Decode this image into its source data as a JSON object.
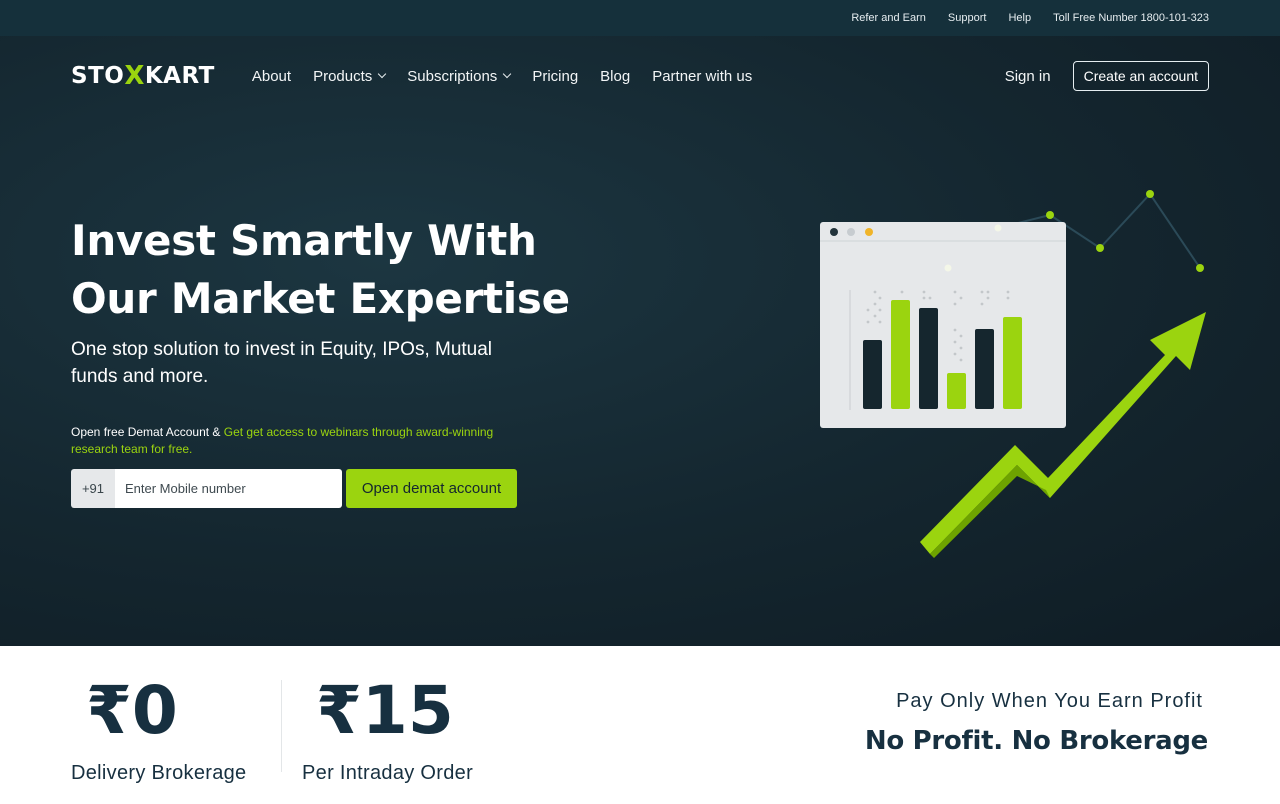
{
  "topbar": {
    "refer": "Refer and Earn",
    "support": "Support",
    "help": "Help",
    "tollfree": "Toll Free Number 1800-101-323"
  },
  "nav": {
    "logo_pre": "STO",
    "logo_x": "X",
    "logo_post": "KART",
    "links": [
      "About",
      "Products",
      "Subscriptions",
      "Pricing",
      "Blog",
      "Partner with us"
    ],
    "signin": "Sign in",
    "create": "Create an account"
  },
  "hero": {
    "headline_1": "Invest Smartly With",
    "headline_2": "Our Market Expertise",
    "subline": "One stop solution to invest in Equity, IPOs, Mutual funds and more.",
    "promo_plain": "Open free Demat Account & ",
    "promo_highlight": "Get get access to webinars through award-winning research team for free.",
    "country_code": "+91",
    "mobile_placeholder": "Enter Mobile number",
    "cta": "Open demat account"
  },
  "stats": {
    "delivery_value": "₹0",
    "delivery_label": "Delivery Brokerage",
    "intraday_value": "₹15",
    "intraday_label": "Per Intraday Order",
    "tagline": "Pay Only When You Earn Profit",
    "headline": "No Profit. No Brokerage"
  },
  "colors": {
    "accent": "#9bd40f",
    "hero_bg": "#14262f",
    "dark_text": "#173040"
  }
}
